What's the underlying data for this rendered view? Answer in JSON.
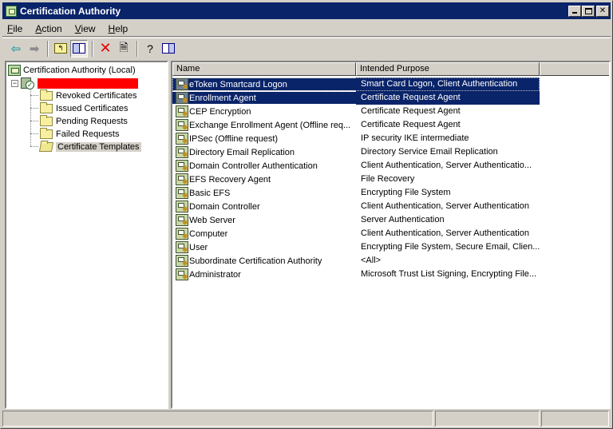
{
  "window": {
    "title": "Certification Authority",
    "controls": {
      "minimize": "minimize",
      "maximize": "maximize",
      "close": "close"
    }
  },
  "menu": {
    "items": [
      {
        "label": "File",
        "accel": "F",
        "rest": "ile"
      },
      {
        "label": "Action",
        "accel": "A",
        "rest": "ction"
      },
      {
        "label": "View",
        "accel": "V",
        "rest": "iew"
      },
      {
        "label": "Help",
        "accel": "H",
        "rest": "elp"
      }
    ]
  },
  "toolbar": {
    "buttons": [
      {
        "name": "back",
        "icon": "arrow-left-icon",
        "glyph": "⇦"
      },
      {
        "name": "forward",
        "icon": "arrow-right-icon",
        "glyph": "➡"
      },
      {
        "name": "up-one-level",
        "icon": "up-folder-icon",
        "glyph": "↰"
      },
      {
        "name": "show-hide-console-tree",
        "icon": "console-tree-icon",
        "pressed": true
      },
      {
        "name": "delete",
        "icon": "delete-icon",
        "glyph": "✕"
      },
      {
        "name": "export-list",
        "icon": "export-list-icon",
        "glyph": "🗎"
      },
      {
        "name": "help",
        "icon": "help-icon",
        "glyph": "?"
      },
      {
        "name": "show-hide-action-pane",
        "icon": "action-pane-icon"
      }
    ]
  },
  "tree": {
    "root": "Certification Authority (Local)",
    "server": {
      "label": "[redacted]",
      "expanded": true
    },
    "children": [
      {
        "label": "Revoked Certificates",
        "selected": false
      },
      {
        "label": "Issued Certificates",
        "selected": false
      },
      {
        "label": "Pending Requests",
        "selected": false
      },
      {
        "label": "Failed Requests",
        "selected": false
      },
      {
        "label": "Certificate Templates",
        "selected": true
      }
    ]
  },
  "list": {
    "columns": [
      "Name",
      "Intended Purpose"
    ],
    "rows": [
      {
        "name": "eToken Smartcard Logon",
        "purpose": "Smart Card Logon, Client Authentication",
        "selected": true,
        "focused": true
      },
      {
        "name": "Enrollment Agent",
        "purpose": "Certificate Request Agent",
        "selected": true
      },
      {
        "name": "CEP Encryption",
        "purpose": "Certificate Request Agent"
      },
      {
        "name": "Exchange Enrollment Agent (Offline req...",
        "purpose": "Certificate Request Agent"
      },
      {
        "name": "IPSec (Offline request)",
        "purpose": "IP security IKE intermediate"
      },
      {
        "name": "Directory Email Replication",
        "purpose": "Directory Service Email Replication"
      },
      {
        "name": "Domain Controller Authentication",
        "purpose": "Client Authentication, Server Authenticatio..."
      },
      {
        "name": "EFS Recovery Agent",
        "purpose": "File Recovery"
      },
      {
        "name": "Basic EFS",
        "purpose": "Encrypting File System"
      },
      {
        "name": "Domain Controller",
        "purpose": "Client Authentication, Server Authentication"
      },
      {
        "name": "Web Server",
        "purpose": "Server Authentication"
      },
      {
        "name": "Computer",
        "purpose": "Client Authentication, Server Authentication"
      },
      {
        "name": "User",
        "purpose": "Encrypting File System, Secure Email, Clien..."
      },
      {
        "name": "Subordinate Certification Authority",
        "purpose": "<All>"
      },
      {
        "name": "Administrator",
        "purpose": "Microsoft Trust List Signing, Encrypting File..."
      }
    ]
  },
  "status": {
    "segments": [
      "",
      "",
      ""
    ]
  },
  "colors": {
    "title_bar": "#0a246a",
    "selection": "#0a246a",
    "face": "#d4d0c8",
    "redaction": "#ff0000"
  }
}
